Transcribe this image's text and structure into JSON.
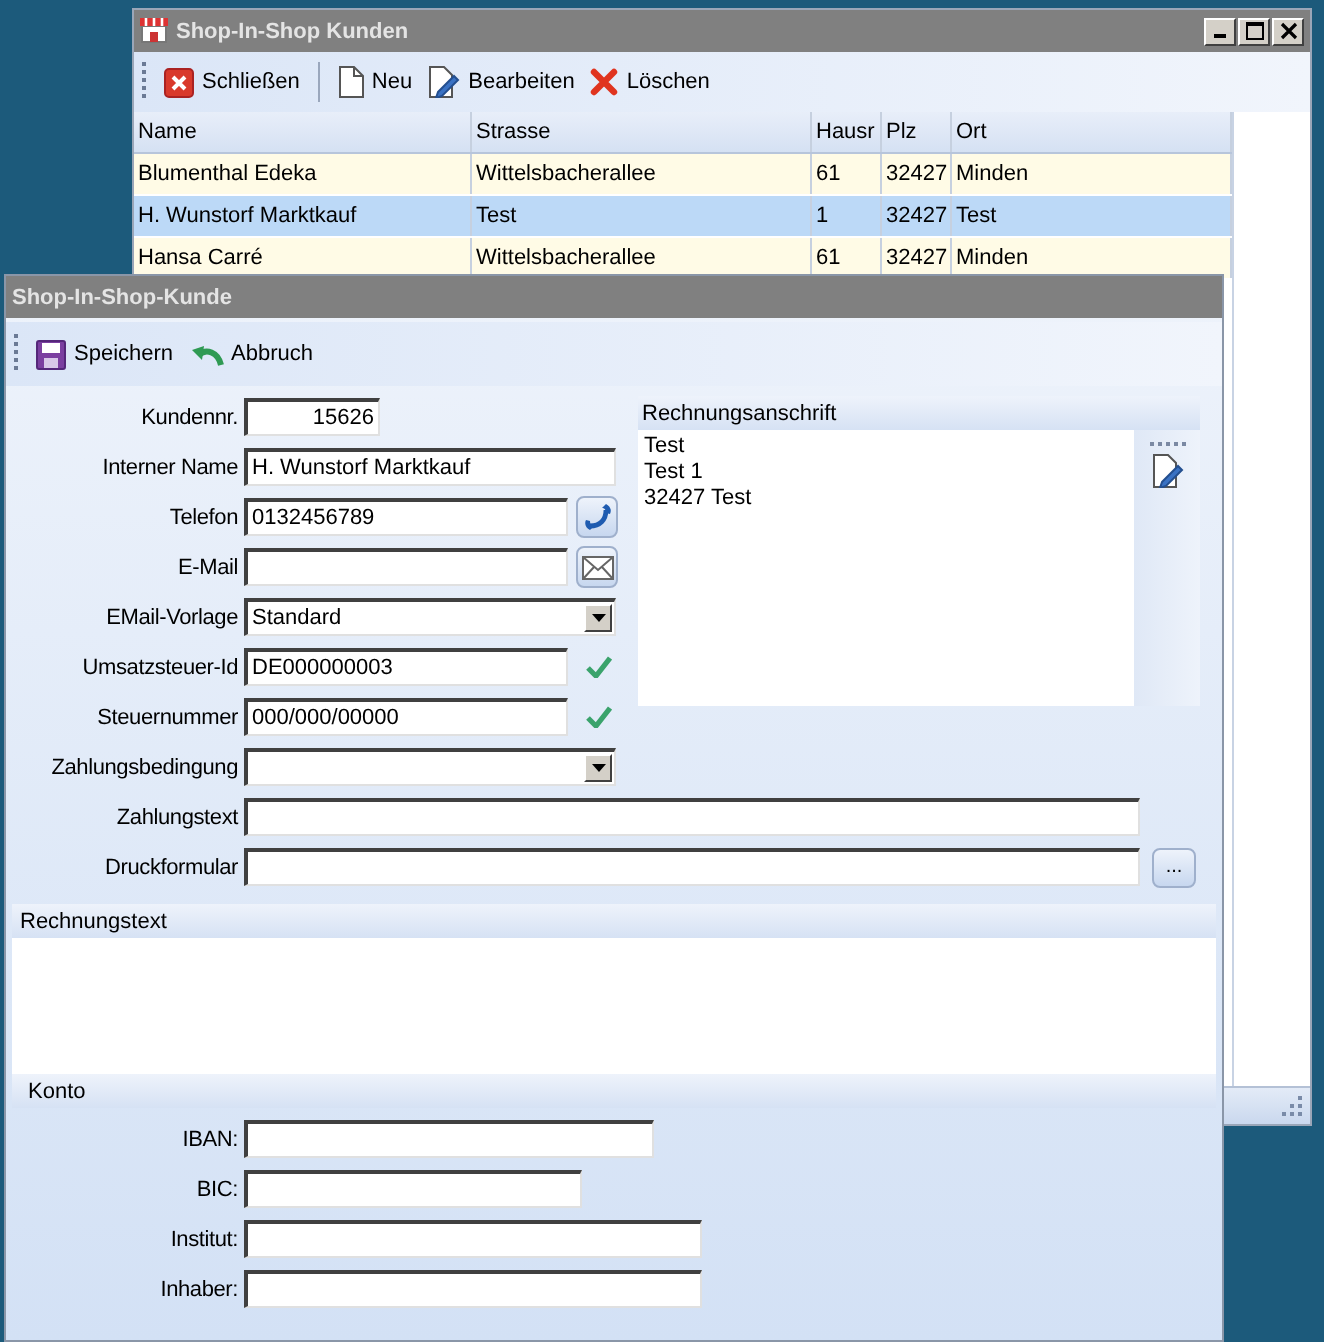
{
  "back_window": {
    "title": "Shop-In-Shop Kunden",
    "toolbar": [
      {
        "kind": "close",
        "label": "Schließen"
      },
      {
        "kind": "new",
        "label": "Neu"
      },
      {
        "kind": "edit",
        "label": "Bearbeiten"
      },
      {
        "kind": "delete",
        "label": "Löschen"
      }
    ],
    "table": {
      "columns": [
        "Name",
        "Strasse",
        "Hausr",
        "Plz",
        "Ort"
      ],
      "rows": [
        {
          "selected": false,
          "cells": [
            "Blumenthal Edeka",
            "Wittelsbacherallee",
            "61",
            "32427",
            "Minden"
          ]
        },
        {
          "selected": true,
          "cells": [
            "H. Wunstorf Marktkauf",
            "Test",
            "1",
            "32427",
            "Test"
          ]
        },
        {
          "selected": false,
          "cells": [
            "Hansa Carré",
            "Wittelsbacherallee",
            "61",
            "32427",
            "Minden"
          ]
        }
      ]
    }
  },
  "dialog": {
    "title": "Shop-In-Shop-Kunde",
    "toolbar": [
      {
        "kind": "save",
        "label": "Speichern"
      },
      {
        "kind": "undo",
        "label": "Abbruch"
      }
    ],
    "fields": [
      {
        "kind": "number",
        "label": "Kundennr.",
        "value": "15626"
      },
      {
        "kind": "text",
        "label": "Interner Name",
        "value": "H. Wunstorf Marktkauf"
      },
      {
        "kind": "phone",
        "label": "Telefon",
        "value": "0132456789"
      },
      {
        "kind": "email",
        "label": "E-Mail"
      },
      {
        "kind": "select",
        "label": "EMail-Vorlage",
        "value": "Standard"
      },
      {
        "kind": "validated",
        "label": "Umsatzsteuer-Id",
        "value": "DE000000003",
        "valid": true
      },
      {
        "kind": "validated",
        "label": "Steuernummer",
        "value": "000/000/00000",
        "valid": true
      },
      {
        "kind": "select",
        "label": "Zahlungsbedingung"
      },
      {
        "kind": "wide",
        "label": "Zahlungstext"
      },
      {
        "kind": "file",
        "label": "Druckformular",
        "button": "..."
      }
    ],
    "address": {
      "title": "Rechnungsanschrift",
      "lines": [
        "Test",
        "Test 1",
        "32427 Test"
      ]
    },
    "invoice_text": {
      "title": "Rechnungstext"
    },
    "account": {
      "title": "Konto",
      "fields": [
        {
          "label": "IBAN:"
        },
        {
          "label": "BIC:"
        },
        {
          "label": "Institut:"
        },
        {
          "label": "Inhaber:"
        }
      ]
    }
  }
}
